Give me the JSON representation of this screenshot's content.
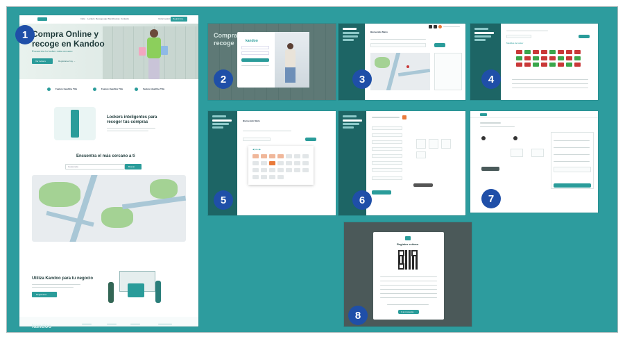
{
  "panels": [
    {
      "number": "1"
    },
    {
      "number": "2"
    },
    {
      "number": "3"
    },
    {
      "number": "4"
    },
    {
      "number": "5"
    },
    {
      "number": "6"
    },
    {
      "number": "7"
    },
    {
      "number": "8"
    }
  ],
  "landing": {
    "nav_items": [
      "Inicio",
      "Lockers",
      "Recoge aquí",
      "Membresías",
      "Contacto"
    ],
    "nav_cta": "Registrarse",
    "hero_title_line1": "Compra Online y",
    "hero_title_line2": "recoge en Kandoo",
    "hero_subtitle": "Encuentra tu locker más cercano",
    "hero_button": "Ver lockers",
    "hero_link": "Registrarse hoy →",
    "features": [
      "Feature Headline Title",
      "Feature Headline Title",
      "Feature Headline Title"
    ],
    "lockers_title_line1": "Lockers inteligentes para",
    "lockers_title_line2": "recoger tus compras",
    "nearest_title": "Encuentra el más cercano a ti",
    "search_placeholder": "Guatemala",
    "search_button": "Buscar",
    "business_title": "Utiliza Kandoo para tu negocio",
    "business_text": "Vende desde una tienda virtual y entrega en tus lockers más cercanos.",
    "business_button": "Registrarse",
    "footer_logo": "kandoo"
  },
  "login": {
    "logo": "kandoo",
    "title_line1": "Compra",
    "title_line2": "recoge"
  },
  "dashboard": {
    "heading": "Bienvenido Mario",
    "sidebar_items": [
      "Inicio",
      "Lockers disponibles",
      "Mis paquetes",
      "Ajustes"
    ]
  },
  "registro": {
    "title": "Registro exitoso",
    "confirm_button": "Ir a mi cuenta"
  },
  "colors": {
    "board": "#2d9c9e",
    "badge": "#1f4fa8",
    "sidebar": "#1d6565",
    "accent": "#2a9c9a",
    "locker_busy": "#c93838",
    "locker_free": "#3aa64b",
    "selected": "#e97a3a"
  }
}
